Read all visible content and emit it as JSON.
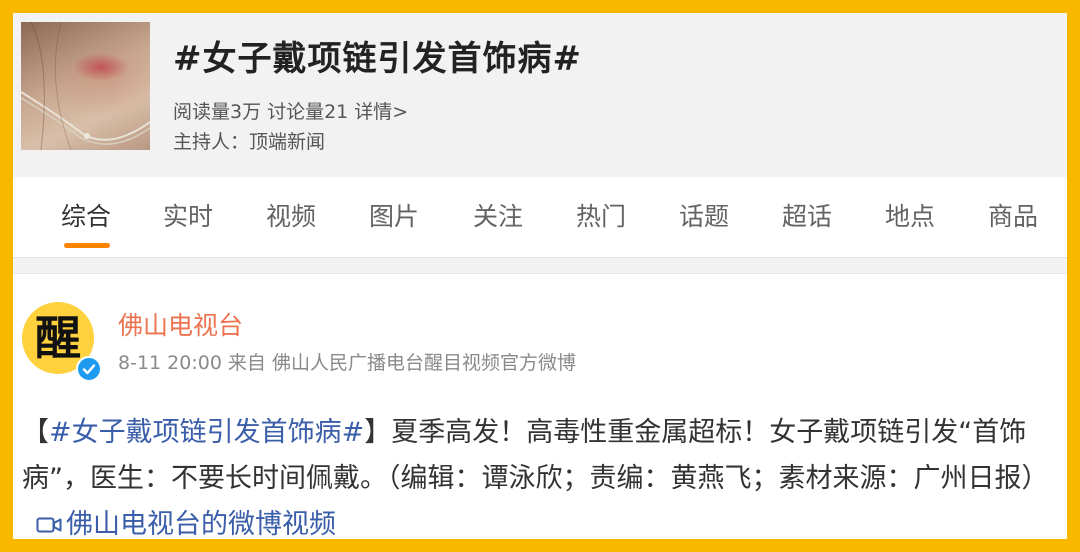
{
  "header": {
    "title": "#女子戴项链引发首饰病#",
    "read_count": "阅读量3万",
    "discuss_count": "讨论量21",
    "details_link": "详情>",
    "host": "主持人：顶端新闻"
  },
  "tabs": [
    {
      "label": "综合",
      "active": true
    },
    {
      "label": "实时"
    },
    {
      "label": "视频"
    },
    {
      "label": "图片"
    },
    {
      "label": "关注"
    },
    {
      "label": "热门"
    },
    {
      "label": "话题"
    },
    {
      "label": "超话"
    },
    {
      "label": "地点"
    },
    {
      "label": "商品"
    }
  ],
  "post": {
    "author": "佛山电视台",
    "avatar_glyph": "醒",
    "time": "8-11 20:00",
    "source": "来自 佛山人民广播电台醒目视频官方微博",
    "topic_bracket_open": "【",
    "topic_link": "#女子戴项链引发首饰病#",
    "topic_bracket_close": "】",
    "text": "夏季高发！高毒性重金属超标！女子戴项链引发“首饰病”，医生：不要长时间佩戴。（编辑：谭泳欣；责编：黄燕飞；素材来源：广州日报）",
    "video_link": "佛山电视台的微博视频"
  },
  "colors": {
    "frame": "#F9B800",
    "accent": "#ff8200",
    "author": "#eb7350",
    "link": "#3a5ea9"
  }
}
